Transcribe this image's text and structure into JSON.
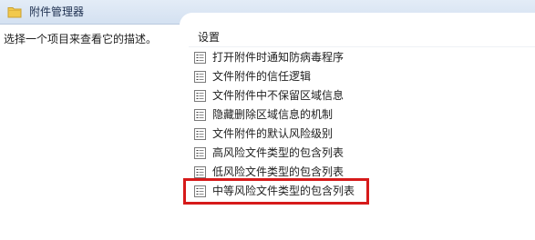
{
  "window": {
    "title": "附件管理器",
    "folder_color": "#f2c94c"
  },
  "details": {
    "description": "选择一个项目来查看它的描述。"
  },
  "settings": {
    "header": "设置",
    "items": [
      {
        "label": "打开附件时通知防病毒程序",
        "icon": "policy-setting-icon"
      },
      {
        "label": "文件附件的信任逻辑",
        "icon": "policy-setting-icon"
      },
      {
        "label": "文件附件中不保留区域信息",
        "icon": "policy-setting-icon"
      },
      {
        "label": "隐藏删除区域信息的机制",
        "icon": "policy-setting-icon"
      },
      {
        "label": "文件附件的默认风险级别",
        "icon": "policy-setting-icon"
      },
      {
        "label": "高风险文件类型的包含列表",
        "icon": "policy-setting-icon"
      },
      {
        "label": "低风险文件类型的包含列表",
        "icon": "policy-setting-icon"
      },
      {
        "label": "中等风险文件类型的包含列表",
        "icon": "policy-setting-icon"
      }
    ]
  },
  "highlight": {
    "target": "中等风险文件类型的包含列表",
    "color": "#d61a1a"
  }
}
